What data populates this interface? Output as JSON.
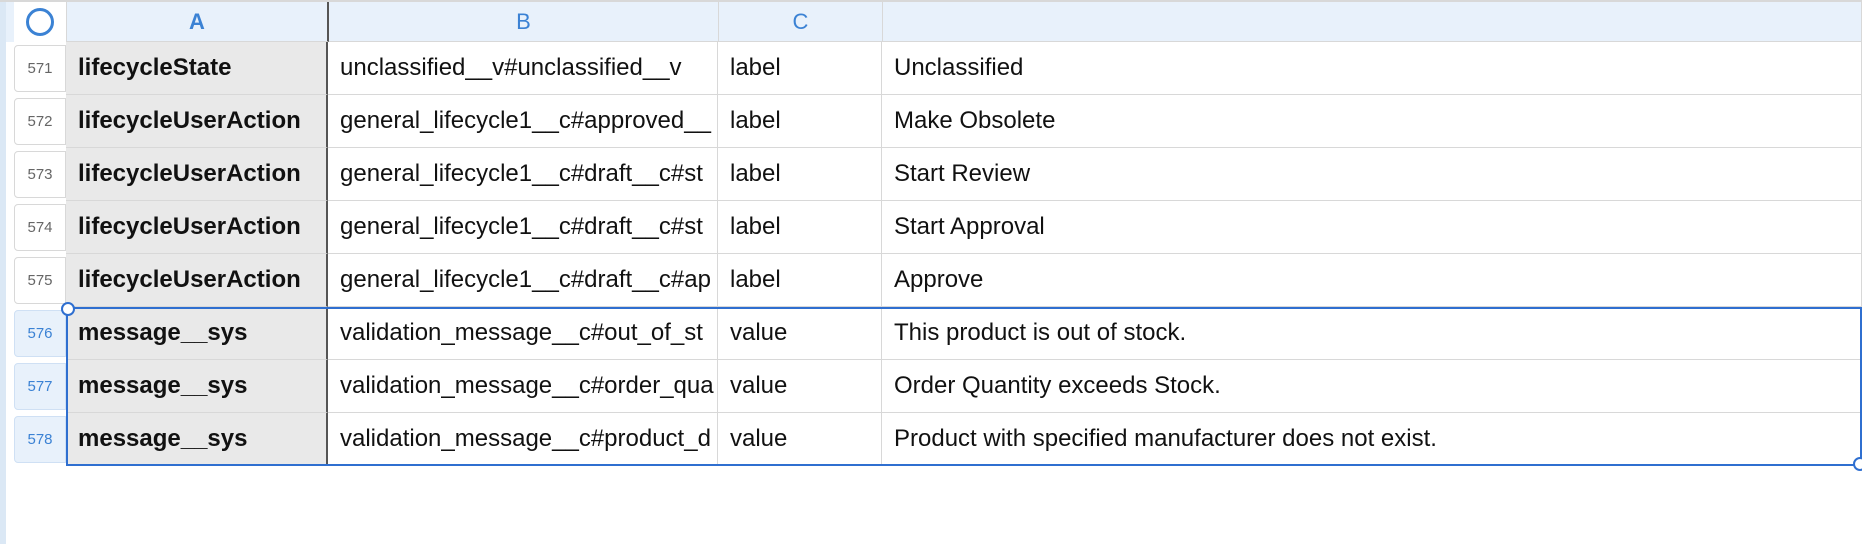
{
  "columns": {
    "A": "A",
    "B": "B",
    "C": "C",
    "D": ""
  },
  "rows": [
    {
      "num": "571",
      "a": "lifecycleState",
      "b": "unclassified__v#unclassified__v",
      "c": "label",
      "d": "Unclassified",
      "selected": false
    },
    {
      "num": "572",
      "a": "lifecycleUserAction",
      "b": "general_lifecycle1__c#approved__",
      "c": "label",
      "d": "Make Obsolete",
      "selected": false
    },
    {
      "num": "573",
      "a": "lifecycleUserAction",
      "b": "general_lifecycle1__c#draft__c#st",
      "c": "label",
      "d": "Start Review",
      "selected": false
    },
    {
      "num": "574",
      "a": "lifecycleUserAction",
      "b": "general_lifecycle1__c#draft__c#st",
      "c": "label",
      "d": "Start Approval",
      "selected": false
    },
    {
      "num": "575",
      "a": "lifecycleUserAction",
      "b": "general_lifecycle1__c#draft__c#ap",
      "c": "label",
      "d": "Approve",
      "selected": false
    },
    {
      "num": "576",
      "a": "message__sys",
      "b": "validation_message__c#out_of_st",
      "c": "value",
      "d": "This product is out of stock.",
      "selected": true
    },
    {
      "num": "577",
      "a": "message__sys",
      "b": "validation_message__c#order_qua",
      "c": "value",
      "d": "Order Quantity exceeds Stock.",
      "selected": true
    },
    {
      "num": "578",
      "a": "message__sys",
      "b": "validation_message__c#product_d",
      "c": "value",
      "d": "Product with specified manufacturer does not exist.",
      "selected": true
    }
  ]
}
